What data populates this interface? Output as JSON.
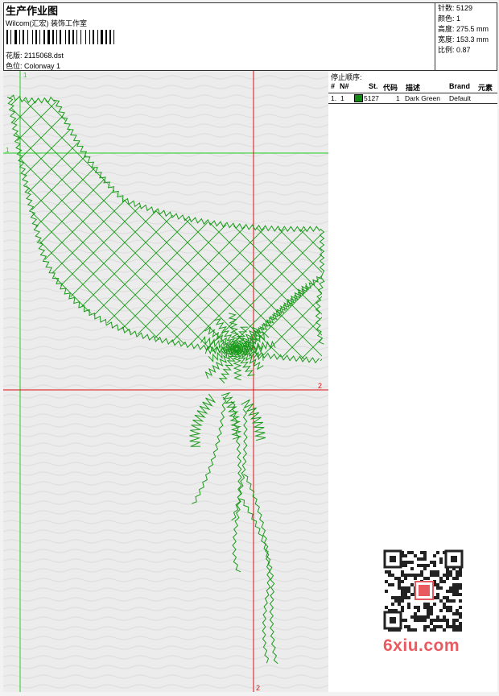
{
  "header": {
    "title": "生产作业图",
    "company": "Wilcom(汇宏) 装饰工作室",
    "file_label": "花版:",
    "file_name": "2115068.dst",
    "colorway_label": "色位:",
    "colorway_name": "Colorway 1"
  },
  "stats": [
    {
      "label": "针数:",
      "value": "5129"
    },
    {
      "label": "颜色:",
      "value": "1"
    },
    {
      "label": "高度:",
      "value": "275.5 mm"
    },
    {
      "label": "宽度:",
      "value": "153.3 mm"
    },
    {
      "label": "比例:",
      "value": "0.87"
    }
  ],
  "stop_sequence": {
    "title": "停止顺序:",
    "columns": [
      "#",
      "N#",
      "St.",
      "代码",
      "描述",
      "Brand",
      "元素"
    ],
    "rows": [
      {
        "index": "1.",
        "needle": "1",
        "stitches": "5127",
        "code": "1",
        "description": "Dark Green",
        "brand": "Default",
        "swatch_color": "#108a10"
      }
    ]
  },
  "guides": {
    "v1_label": "1",
    "h1_label": "1",
    "h2_label": "2",
    "v2_label": "2",
    "green_color": "#22cc22",
    "red_color": "#dd1111"
  },
  "design_color": "#1a9a1a",
  "watermark": "6xiu.com"
}
